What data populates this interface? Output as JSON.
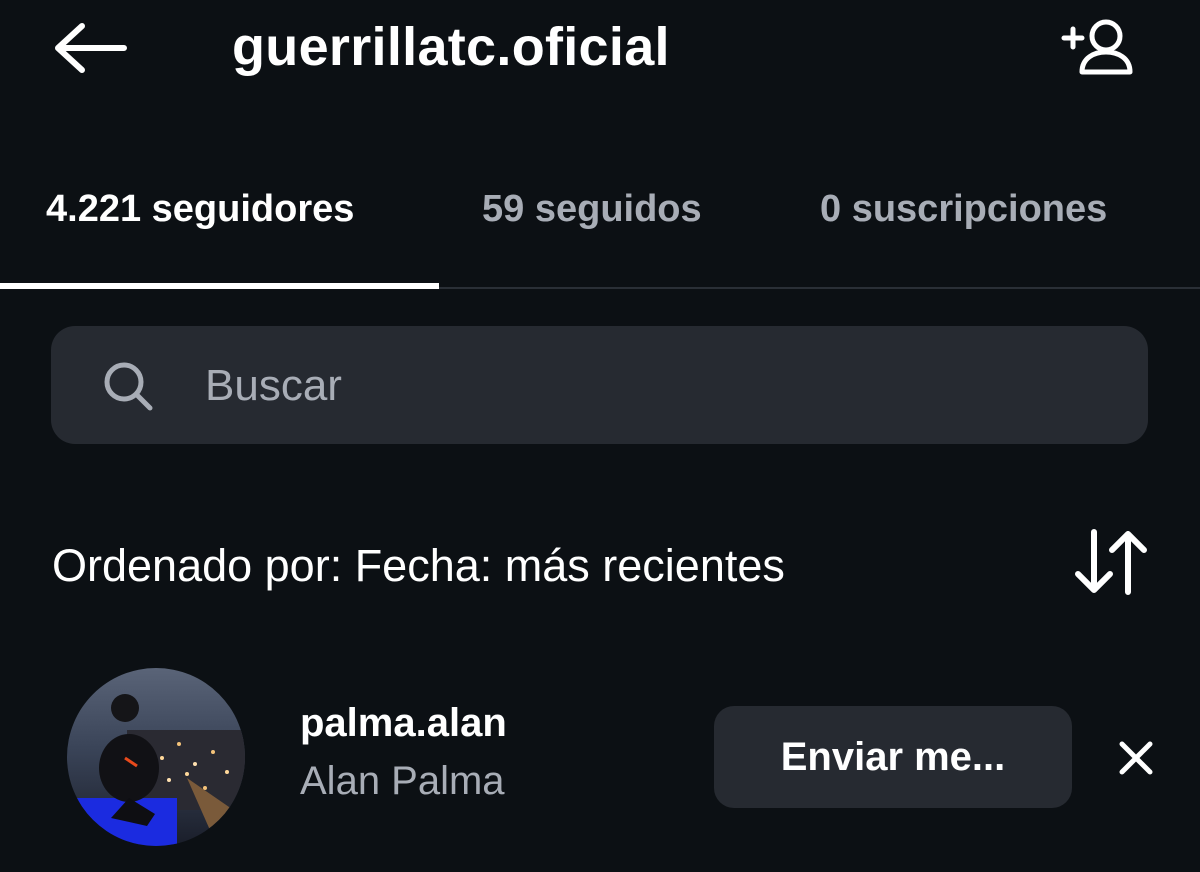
{
  "header": {
    "title": "guerrillatc.oficial",
    "back_icon": "arrow-left-icon",
    "add_icon": "add-person-icon"
  },
  "tabs": [
    {
      "count": "4.221",
      "label": "seguidores",
      "active": true
    },
    {
      "count": "59",
      "label": "seguidos",
      "active": false
    },
    {
      "count": "0",
      "label": "suscripciones",
      "active": false
    }
  ],
  "search": {
    "placeholder": "Buscar",
    "value": "",
    "icon": "search-icon"
  },
  "sort": {
    "label": "Ordenado por: Fecha: más recientes",
    "icon": "sort-arrows-icon"
  },
  "followers": [
    {
      "username": "palma.alan",
      "full_name": "Alan Palma",
      "action_label": "Enviar me...",
      "remove_icon": "close-icon"
    }
  ],
  "colors": {
    "background": "#0c1014",
    "surface": "#262a31",
    "text_primary": "#ffffff",
    "text_secondary": "#a8adb6"
  }
}
